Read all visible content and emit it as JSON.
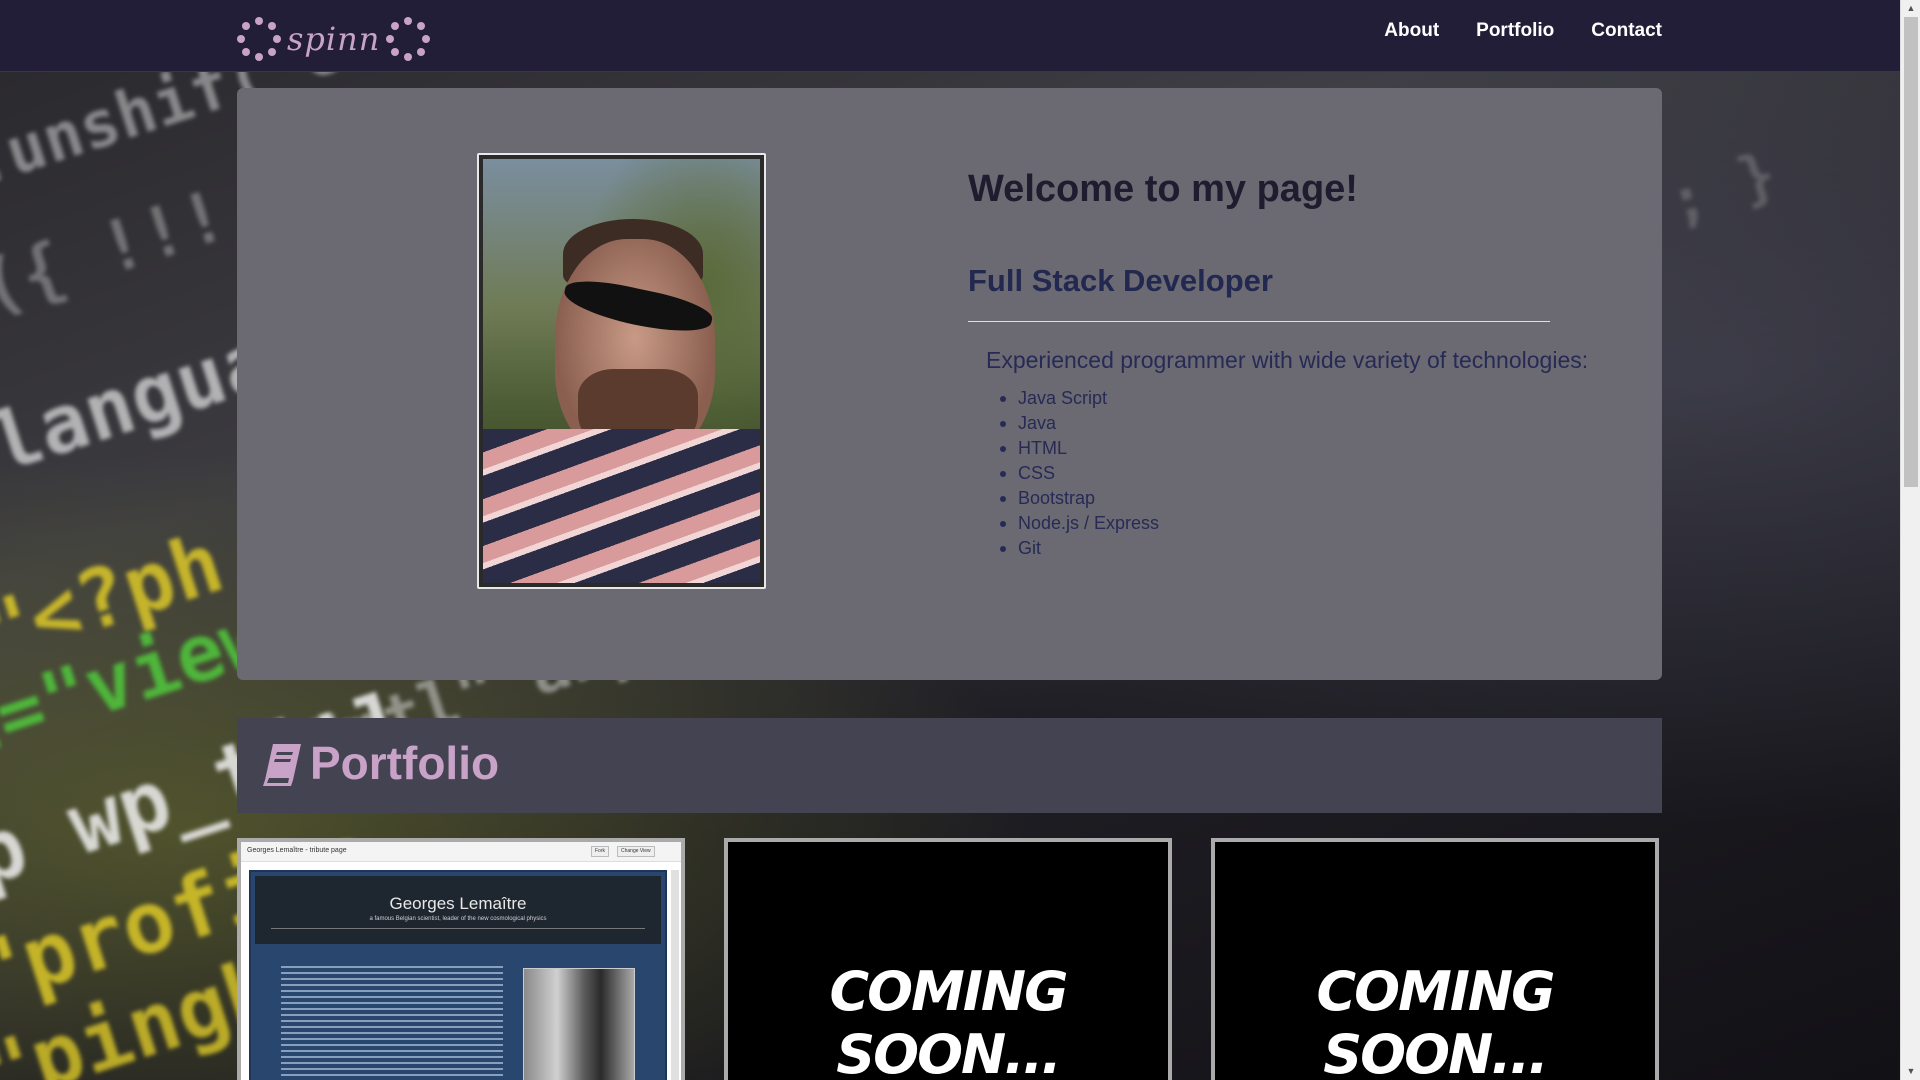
{
  "navbar": {
    "logo_text": "spinn",
    "links": [
      {
        "label": "About"
      },
      {
        "label": "Portfolio"
      },
      {
        "label": "Contact"
      }
    ]
  },
  "hero": {
    "title": "Welcome to my page!",
    "subtitle": "Full Stack Developer",
    "description": "Experienced programmer with wide variety of technologies:",
    "technologies": [
      "Java Script",
      "Java",
      "HTML",
      "CSS",
      "Bootstrap",
      "Node.js / Express",
      "Git"
    ]
  },
  "portfolio": {
    "title": "Portfolio",
    "icon": "book-icon",
    "cards": [
      {
        "tab_title": "Georges Lemaître - tribute page",
        "btn_fork": "Fork",
        "btn_change_view": "Change View",
        "page_title": "Georges Lemaître",
        "page_subtitle": "a famous Belgian scientist, leader of the new cosmological physics"
      },
      {
        "label": "COMING SOON..."
      },
      {
        "label": "COMING SOON..."
      }
    ]
  },
  "colors": {
    "navbar_bg": "#231e38",
    "accent_pink": "#c9a2c8",
    "hero_bg": "#6b6a73",
    "portfolio_header_bg": "#434352"
  }
}
